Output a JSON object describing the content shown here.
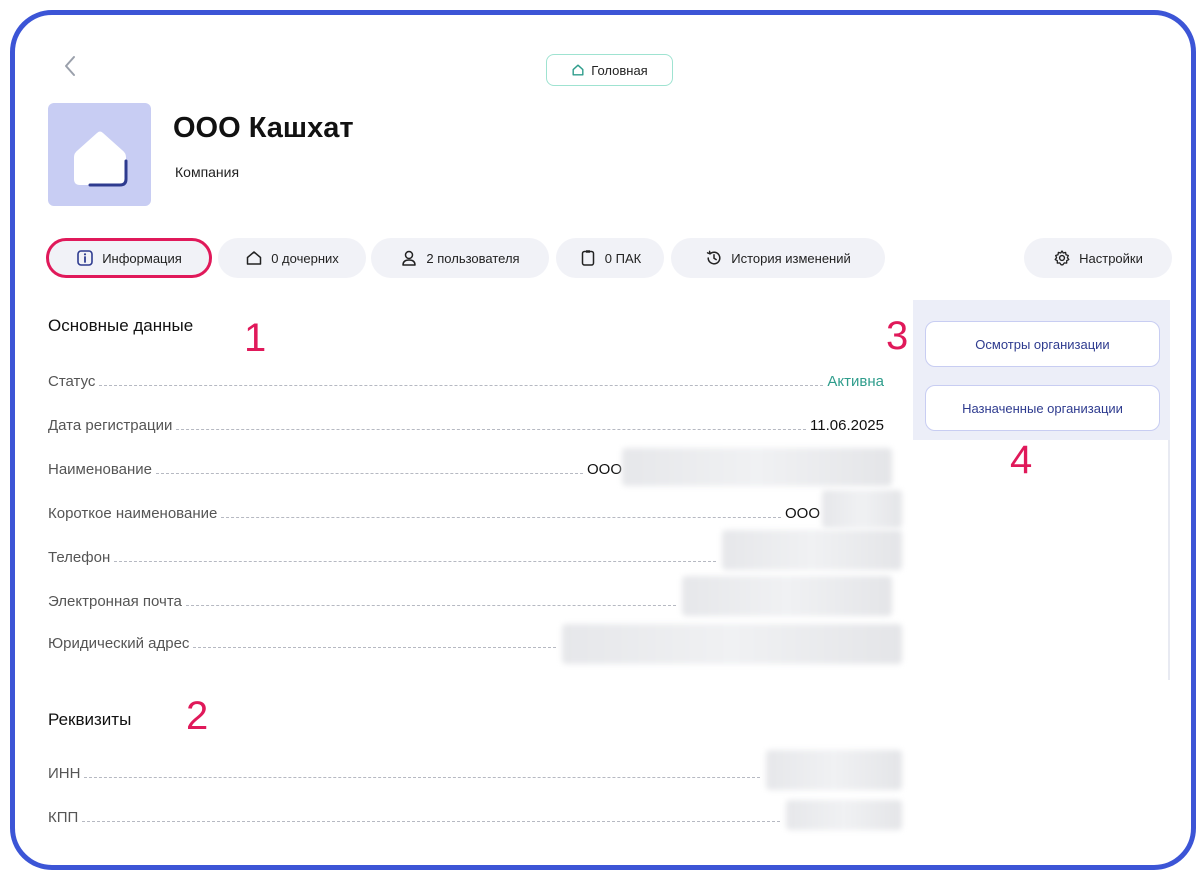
{
  "header": {
    "back_icon": "chevron-left-icon",
    "crumb": {
      "icon": "home-icon",
      "label": "Головная"
    }
  },
  "company": {
    "title": "ООО Кашхат",
    "subtitle": "Компания"
  },
  "tabs": [
    {
      "icon": "info-icon",
      "label": "Информация",
      "active": true
    },
    {
      "icon": "home-icon",
      "label": "0 дочерних"
    },
    {
      "icon": "user-icon",
      "label": "2 пользователя"
    },
    {
      "icon": "clipboard-icon",
      "label": "0 ПАК"
    },
    {
      "icon": "history-icon",
      "label": "История изменений"
    },
    {
      "icon": "gear-icon",
      "label": "Настройки"
    }
  ],
  "main": {
    "section_title": "Основные данные",
    "rows": [
      {
        "label": "Статус",
        "value": "Активна"
      },
      {
        "label": "Дата регистрации",
        "value": "11.06.2025"
      },
      {
        "label": "Наименование",
        "value": "ООО"
      },
      {
        "label": "Короткое наименование",
        "value": "ООО"
      },
      {
        "label": "Телефон",
        "value": ""
      },
      {
        "label": "Электронная почта",
        "value": ""
      },
      {
        "label": "Юридический адрес",
        "value": ""
      }
    ]
  },
  "requisites": {
    "section_title": "Реквизиты",
    "rows": [
      {
        "label": "ИНН",
        "value": ""
      },
      {
        "label": "КПП",
        "value": ""
      }
    ]
  },
  "side_panel": {
    "buttons": [
      {
        "label": "Осмотры организации"
      },
      {
        "label": "Назначенные организации"
      }
    ]
  },
  "annotations": [
    "1",
    "2",
    "3",
    "4"
  ],
  "colors": {
    "accent": "#3c55d6",
    "annotation": "#e0195a",
    "status_active": "#2f9d8c",
    "crumb_border": "#9fe3d1"
  }
}
